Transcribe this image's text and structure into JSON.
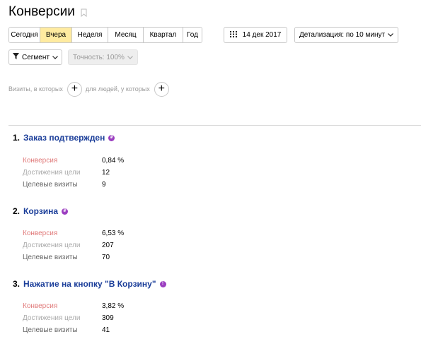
{
  "header": {
    "title": "Конверсии"
  },
  "periods": [
    {
      "label": "Сегодня",
      "active": false
    },
    {
      "label": "Вчера",
      "active": true
    },
    {
      "label": "Неделя",
      "active": false
    },
    {
      "label": "Месяц",
      "active": false
    },
    {
      "label": "Квартал",
      "active": false
    },
    {
      "label": "Год",
      "active": false
    }
  ],
  "date": {
    "label": "14 дек 2017"
  },
  "detail": {
    "label": "Детализация: по 10 минут"
  },
  "segment": {
    "label": "Сегмент"
  },
  "accuracy": {
    "label": "Точность: 100%"
  },
  "filters": {
    "visits_label": "Визиты, в которых",
    "people_label": "для людей, у которых"
  },
  "metric_labels": {
    "conversion": "Конверсия",
    "achievements": "Достижения цели",
    "visits": "Целевые визиты"
  },
  "goals": [
    {
      "number": "1.",
      "name": "Заказ подтвержден",
      "icon": "ecommerce-badge-icon",
      "conversion": "0,84 %",
      "achievements": "12",
      "visits": "9"
    },
    {
      "number": "2.",
      "name": "Корзина",
      "icon": "ecommerce-badge-icon",
      "conversion": "6,53 %",
      "achievements": "207",
      "visits": "70"
    },
    {
      "number": "3.",
      "name": "Нажатие на кнопку \"В Корзину\"",
      "icon": "info-badge-icon",
      "conversion": "3,82 %",
      "achievements": "309",
      "visits": "41"
    }
  ],
  "colors": {
    "accent_active": "#ffeba0",
    "goal_link": "#1a3d99",
    "badge": "#9b3ec0",
    "conversion_label": "#e07b7b"
  }
}
